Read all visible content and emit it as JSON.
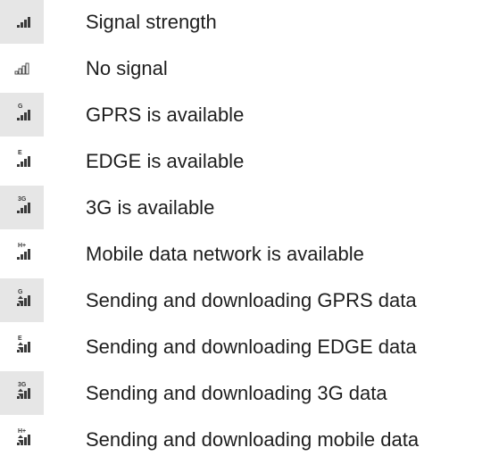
{
  "colors": {
    "text": "#1e1e1e",
    "icon": "#3a3a3a",
    "shade": "#e6e6e6"
  },
  "rows": [
    {
      "icon": "signal-strength-icon",
      "badge": "",
      "arrows": false,
      "empty": false,
      "shaded": true,
      "label": "Signal strength"
    },
    {
      "icon": "no-signal-icon",
      "badge": "",
      "arrows": false,
      "empty": true,
      "shaded": false,
      "label": "No signal"
    },
    {
      "icon": "gprs-signal-icon",
      "badge": "G",
      "arrows": false,
      "empty": false,
      "shaded": true,
      "label": "GPRS is available"
    },
    {
      "icon": "edge-signal-icon",
      "badge": "E",
      "arrows": false,
      "empty": false,
      "shaded": false,
      "label": "EDGE is available"
    },
    {
      "icon": "3g-signal-icon",
      "badge": "3G",
      "arrows": false,
      "empty": false,
      "shaded": true,
      "label": "3G is available"
    },
    {
      "icon": "hplus-signal-icon",
      "badge": "H+",
      "arrows": false,
      "empty": false,
      "shaded": false,
      "label": "Mobile data network is available"
    },
    {
      "icon": "gprs-data-transfer-icon",
      "badge": "G",
      "arrows": true,
      "empty": false,
      "shaded": true,
      "label": "Sending and downloading GPRS data"
    },
    {
      "icon": "edge-data-transfer-icon",
      "badge": "E",
      "arrows": true,
      "empty": false,
      "shaded": false,
      "label": "Sending and downloading EDGE data"
    },
    {
      "icon": "3g-data-transfer-icon",
      "badge": "3G",
      "arrows": true,
      "empty": false,
      "shaded": true,
      "label": "Sending and downloading 3G data"
    },
    {
      "icon": "hplus-data-transfer-icon",
      "badge": "H+",
      "arrows": true,
      "empty": false,
      "shaded": false,
      "label": "Sending and downloading mobile data"
    }
  ]
}
